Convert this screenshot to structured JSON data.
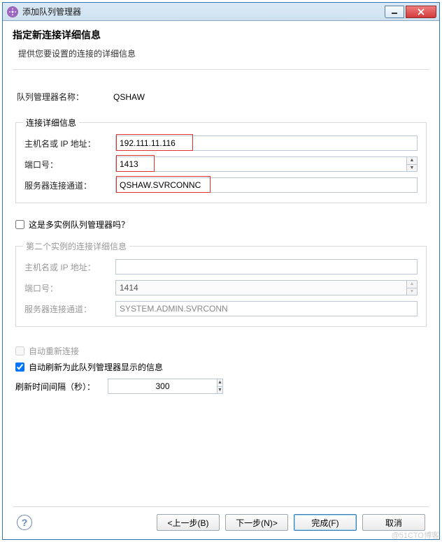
{
  "titlebar": {
    "title": "添加队列管理器"
  },
  "header": {
    "title": "指定新连接详细信息",
    "subtitle": "提供您要设置的连接的详细信息"
  },
  "form": {
    "qmgr_name_label": "队列管理器名称：",
    "qmgr_name_value": "QSHAW",
    "details_group_label": "连接详细信息",
    "host_label": "主机名或 IP 地址：",
    "host_value": "192.111.11.116",
    "port_label": "端口号：",
    "port_value": "1413",
    "channel_label": "服务器连接通道：",
    "channel_value": "QSHAW.SVRCONNC",
    "multi_instance_label": "这是多实例队列管理器吗？",
    "second_group_label": "第二个实例的连接详细信息",
    "host2_label": "主机名或 IP 地址：",
    "host2_value": "",
    "port2_label": "端口号：",
    "port2_value": "1414",
    "channel2_label": "服务器连接通道：",
    "channel2_value": "SYSTEM.ADMIN.SVRCONN",
    "auto_reconnect_label": "自动重新连接",
    "auto_refresh_label": "自动刷新为此队列管理器显示的信息",
    "refresh_interval_label": "刷新时间间隔（秒）：",
    "refresh_interval_value": "300"
  },
  "footer": {
    "back": "<上一步(B)",
    "next": "下一步(N)>",
    "finish": "完成(F)",
    "cancel": "取消"
  },
  "watermark": "@51CTO博客"
}
